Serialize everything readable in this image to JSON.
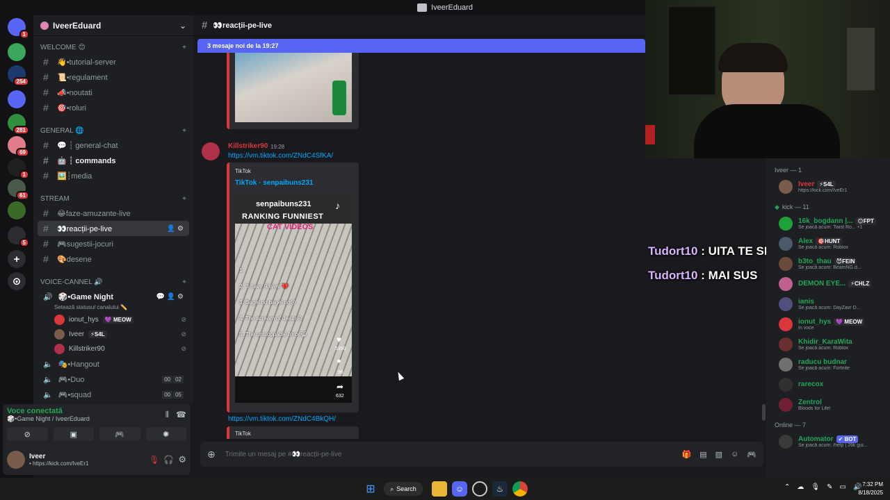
{
  "window": {
    "title": "IveerEduard"
  },
  "servers": [
    {
      "badge": "1",
      "color": "#5865f2"
    },
    {
      "badge": "",
      "color": "#3ba55c"
    },
    {
      "badge": "254",
      "color": "#1c3a6e"
    },
    {
      "badge": "",
      "color": "#5865f2"
    },
    {
      "badge": "281",
      "color": "#2f8f3e"
    },
    {
      "badge": "69",
      "color": "#e27b8c"
    },
    {
      "badge": "1",
      "color": "#202020"
    },
    {
      "badge": "61",
      "color": "#4a5a4a"
    },
    {
      "badge": "",
      "color": "#3a6a2a"
    },
    {
      "badge": "5",
      "color": "#2b2d31"
    }
  ],
  "guild": {
    "name": "IveerEduard"
  },
  "categories": {
    "welcome": "WELCOME 😊",
    "general": "GENERAL 🌐",
    "stream": "STREAM",
    "voice": "VOICE-CANNEL 🔊"
  },
  "channels": {
    "welcome": [
      "👋•tutorial-server",
      "📜•regulament",
      "📣•noutati",
      "🎯•roluri"
    ],
    "general": [
      "💬 ┆ general-chat",
      "🤖 ┆ commands",
      "🖼️┆media"
    ],
    "stream": [
      "😂faze-amuzante-live",
      "👀reacții-pe-live",
      "🎮sugestii-jocuri",
      "🎨desene"
    ],
    "voice_active": "🎲•Game Night",
    "voice_status": "Setează statusul canalului ✏️",
    "voice_users": [
      {
        "name": "ionut_hys",
        "tag": "💜 MEOW",
        "color": "#da373c"
      },
      {
        "name": "Iveer",
        "tag": "⚡S4L",
        "color": "#7a5c4a"
      },
      {
        "name": "Killstriker90",
        "tag": "",
        "color": "#b0304a"
      }
    ],
    "voice_others": [
      {
        "name": "🎭•Hangout",
        "a": "",
        "b": ""
      },
      {
        "name": "🎮•Duo",
        "a": "00",
        "b": "02"
      },
      {
        "name": "🎮•squad",
        "a": "00",
        "b": "05"
      }
    ]
  },
  "voice_panel": {
    "status": "Voce conectată",
    "location": "🎲•Game Night / IveerEduard"
  },
  "user_panel": {
    "name": "Iveer",
    "status": "• https://kick.com/IveEr1"
  },
  "chat": {
    "channel": "👀reacții-pe-live",
    "new_messages": "3 mesaje noi de la 19:27",
    "author": "Killstriker90",
    "time": "19:28",
    "link1": "https://vm.tiktok.com/ZNdC4SfKA/",
    "provider": "TikTok",
    "embed_title": "TikTok · senpaibuns231",
    "video_user": "senpaibuns231",
    "video_title": "RANKING FUNNIEST",
    "video_sub": "CAT VIDEOS",
    "video_list": [
      "1.",
      "2. \"I have 9 lives\"💔",
      "3. Bagel no bagel no😢",
      "4. The scream of death😩",
      "5. The unstoppable force😹"
    ],
    "likes": "5390",
    "comments": "96",
    "shares": "632",
    "link2": "https://vm.tiktok.com/ZNdC4BkQH/",
    "provider2": "TikTok",
    "placeholder": "Trimite un mesaj pe #👀reacții-pe-live"
  },
  "overlay_chat": [
    {
      "user": "Tudort10",
      "text": " : UITA TE SI LA ALE MELE"
    },
    {
      "user": "Tudort10",
      "text": " : MAI SUS"
    }
  ],
  "members": {
    "group1": "Iveer — 1",
    "group2": "kick — 11",
    "group3": "Online — 7",
    "list1": [
      {
        "name": "Iveer",
        "tag": "⚡S4L",
        "status": "https://kick.com/IveEr1",
        "color": "#7a5c4a",
        "name_color": "#da373c"
      }
    ],
    "list2": [
      {
        "name": "16k_bogdann |...",
        "tag": "😊FPT",
        "status": "Se joacă acum: Twist Ro... +1",
        "color": "#1fa13a"
      },
      {
        "name": "Alex",
        "tag": "🎯HUNT",
        "status": "Se joacă acum: Roblox",
        "color": "#4a5a6a"
      },
      {
        "name": "b3to_thau",
        "tag": "😈FEIN",
        "status": "Se joacă acum: BeamNG.d...",
        "color": "#6a4a3a"
      },
      {
        "name": "DEMON EYE...",
        "tag": "⚡CHLZ",
        "status": "",
        "color": "#c06090"
      },
      {
        "name": "ianis",
        "tag": "",
        "status": "Se joacă acum: DayZavr D...",
        "color": "#505080"
      },
      {
        "name": "ionut_hys",
        "tag": "💜 MEOW",
        "status": "În voce",
        "color": "#da373c"
      },
      {
        "name": "Khidir_KaraWita",
        "tag": "",
        "status": "Se joacă acum: Roblox",
        "color": "#6a3030"
      },
      {
        "name": "raducu budnar",
        "tag": "",
        "status": "Se joacă acum: Fortnite",
        "color": "#707070"
      },
      {
        "name": "rarecox",
        "tag": "",
        "status": "",
        "color": "#303030"
      },
      {
        "name": "Zentrol",
        "tag": "",
        "status": "Bloods for Life!",
        "color": "#702030"
      }
    ],
    "list3": [
      {
        "name": "Automator",
        "tag": "✔ BOT",
        "status": "Se joacă acum: /help | 26k gui...",
        "color": "#3a3a3a"
      }
    ]
  },
  "taskbar": {
    "search": "Search",
    "time": "7:32 PM",
    "date": "8/18/2025"
  }
}
